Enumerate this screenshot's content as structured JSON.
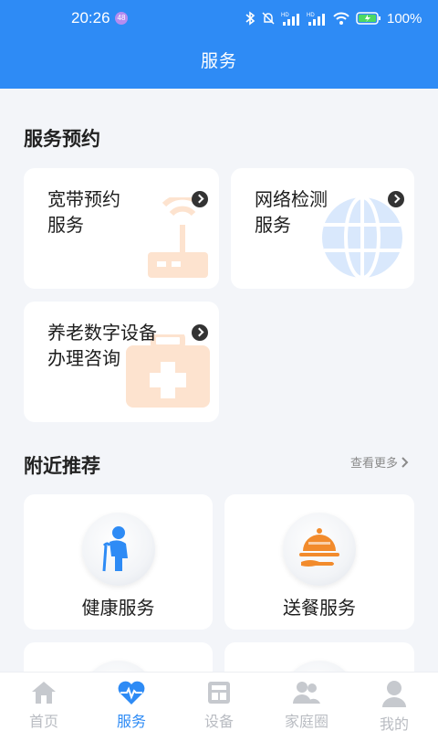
{
  "status_bar": {
    "time": "20:26",
    "badge": "48",
    "battery": "100%"
  },
  "header": {
    "title": "服务"
  },
  "booking": {
    "title": "服务预约",
    "cards": [
      {
        "label": "宽带预约\n服务",
        "icon": "router-icon"
      },
      {
        "label": "网络检测\n服务",
        "icon": "globe-icon"
      },
      {
        "label": "养老数字设备\n办理咨询",
        "icon": "medical-kit-icon"
      }
    ]
  },
  "nearby": {
    "title": "附近推荐",
    "more": "查看更多",
    "items": [
      {
        "label": "健康服务",
        "icon": "elderly-person-icon"
      },
      {
        "label": "送餐服务",
        "icon": "food-cloche-icon"
      }
    ]
  },
  "tabbar": {
    "items": [
      {
        "label": "首页",
        "icon": "home-icon",
        "active": false
      },
      {
        "label": "服务",
        "icon": "heartbeat-icon",
        "active": true
      },
      {
        "label": "设备",
        "icon": "device-icon",
        "active": false
      },
      {
        "label": "家庭圈",
        "icon": "family-icon",
        "active": false
      },
      {
        "label": "我的",
        "icon": "person-icon",
        "active": false
      }
    ]
  },
  "colors": {
    "primary": "#2e8bf5",
    "background": "#f3f5f9",
    "orange_accent": "#f28b2c",
    "inactive_tab": "#b9bcc2"
  }
}
